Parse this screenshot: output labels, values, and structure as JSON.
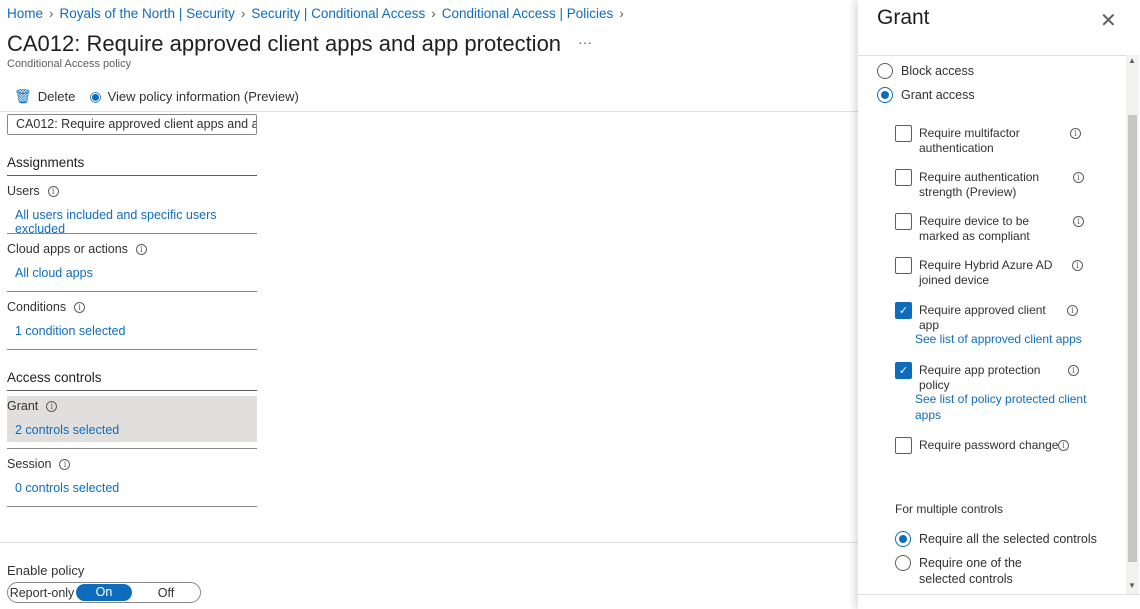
{
  "breadcrumb": [
    "Home",
    "Royals of the North | Security",
    "Security | Conditional Access",
    "Conditional Access | Policies"
  ],
  "page": {
    "title": "CA012: Require approved client apps and app protection",
    "more": "···",
    "subtitle": "Conditional Access policy"
  },
  "toolbar": {
    "delete": "Delete",
    "view_info": "View policy information (Preview)"
  },
  "name_field": {
    "value": "CA012: Require approved client apps and a..."
  },
  "assignments": {
    "heading": "Assignments",
    "users_label": "Users",
    "users_value": "All users included and specific users excluded",
    "apps_label": "Cloud apps or actions",
    "apps_value": "All cloud apps",
    "conditions_label": "Conditions",
    "conditions_value": "1 condition selected"
  },
  "access_controls": {
    "heading": "Access controls",
    "grant_label": "Grant",
    "grant_value": "2 controls selected",
    "session_label": "Session",
    "session_value": "0 controls selected"
  },
  "enable_policy": {
    "label": "Enable policy",
    "options": [
      "Report-only",
      "On",
      "Off"
    ],
    "selected": "On"
  },
  "grant_panel": {
    "title": "Grant",
    "block": "Block access",
    "grant": "Grant access",
    "selected_mode": "Grant access",
    "controls": [
      {
        "label": "Require multifactor authentication",
        "checked": false
      },
      {
        "label": "Require authentication strength (Preview)",
        "checked": false
      },
      {
        "label": "Require device to be marked as compliant",
        "checked": false
      },
      {
        "label": "Require Hybrid Azure AD joined device",
        "checked": false
      },
      {
        "label": "Require approved client app",
        "checked": true,
        "link": "See list of approved client apps"
      },
      {
        "label": "Require app protection policy",
        "checked": true,
        "link": "See list of policy protected client apps"
      },
      {
        "label": "Require password change",
        "checked": false
      }
    ],
    "multiple_heading": "For multiple controls",
    "multi_all": "Require all the selected controls",
    "multi_one": "Require one of the selected controls",
    "multi_selected": "all"
  },
  "colors": {
    "accent": "#0f6cbd",
    "selected_row": "#e1dfdd"
  }
}
